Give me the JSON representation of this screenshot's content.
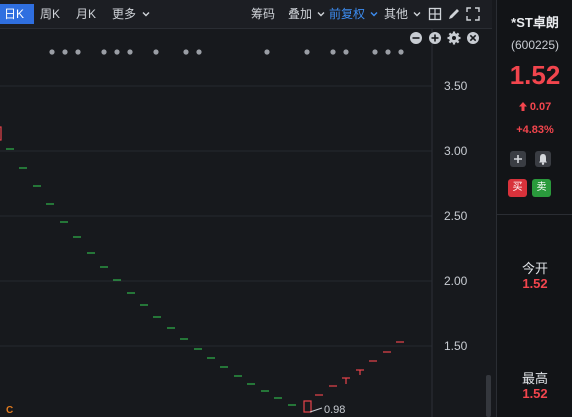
{
  "toolbar": {
    "period_day": "日K",
    "period_week": "周K",
    "period_month": "月K",
    "more": "更多",
    "chip": "筹码",
    "overlay": "叠加",
    "adjust": "前复权",
    "other": "其他"
  },
  "chart": {
    "y_ticks": [
      "3.50",
      "3.00",
      "2.50",
      "2.00",
      "1.50"
    ],
    "low_label": "0.98",
    "marker_c": "C",
    "colors": {
      "up": "#e8434b",
      "down": "#2fb34a",
      "accent": "#3c8cf0"
    }
  },
  "side": {
    "name": "*ST卓朗",
    "code": "(600225)",
    "price": "1.52",
    "change": "0.07",
    "change_pct": "+4.83%",
    "buy": "买",
    "sell": "卖",
    "open_label": "今开",
    "open_value": "1.52",
    "high_label": "最高",
    "high_value": "1.52"
  }
}
